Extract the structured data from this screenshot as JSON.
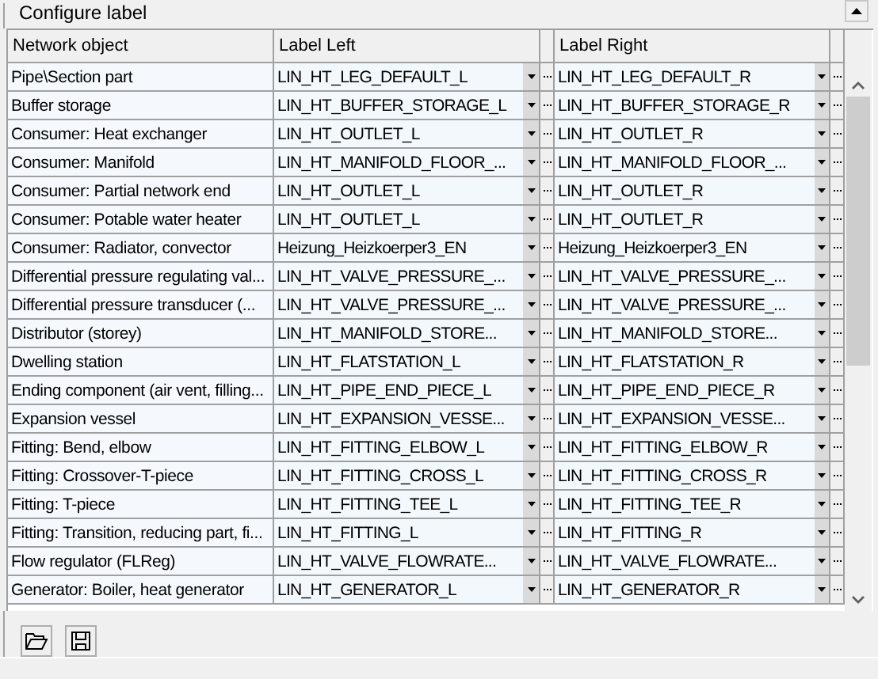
{
  "group": {
    "title": "Configure label"
  },
  "columns": [
    "Network object",
    "Label Left",
    "Label Right"
  ],
  "rows": [
    {
      "object": "Pipe\\Section part",
      "label_left": "LIN_HT_LEG_DEFAULT_L",
      "label_right": "LIN_HT_LEG_DEFAULT_R"
    },
    {
      "object": "Buffer storage",
      "label_left": "LIN_HT_BUFFER_STORAGE_L",
      "label_right": "LIN_HT_BUFFER_STORAGE_R"
    },
    {
      "object": "Consumer: Heat exchanger",
      "label_left": "LIN_HT_OUTLET_L",
      "label_right": "LIN_HT_OUTLET_R"
    },
    {
      "object": "Consumer: Manifold",
      "label_left": "LIN_HT_MANIFOLD_FLOOR_...",
      "label_right": "LIN_HT_MANIFOLD_FLOOR_..."
    },
    {
      "object": "Consumer: Partial network end",
      "label_left": "LIN_HT_OUTLET_L",
      "label_right": "LIN_HT_OUTLET_R"
    },
    {
      "object": "Consumer: Potable water heater",
      "label_left": "LIN_HT_OUTLET_L",
      "label_right": "LIN_HT_OUTLET_R"
    },
    {
      "object": "Consumer: Radiator, convector",
      "label_left": "Heizung_Heizkoerper3_EN",
      "label_right": "Heizung_Heizkoerper3_EN"
    },
    {
      "object": "Differential pressure regulating val...",
      "label_left": "LIN_HT_VALVE_PRESSURE_...",
      "label_right": "LIN_HT_VALVE_PRESSURE_..."
    },
    {
      "object": "Differential pressure transducer (...",
      "label_left": "LIN_HT_VALVE_PRESSURE_...",
      "label_right": "LIN_HT_VALVE_PRESSURE_..."
    },
    {
      "object": "Distributor (storey)",
      "label_left": "LIN_HT_MANIFOLD_STORE...",
      "label_right": "LIN_HT_MANIFOLD_STORE..."
    },
    {
      "object": "Dwelling station",
      "label_left": "LIN_HT_FLATSTATION_L",
      "label_right": "LIN_HT_FLATSTATION_R"
    },
    {
      "object": "Ending component (air vent, filling...",
      "label_left": "LIN_HT_PIPE_END_PIECE_L",
      "label_right": "LIN_HT_PIPE_END_PIECE_R"
    },
    {
      "object": "Expansion vessel",
      "label_left": "LIN_HT_EXPANSION_VESSE...",
      "label_right": "LIN_HT_EXPANSION_VESSE..."
    },
    {
      "object": "Fitting: Bend, elbow",
      "label_left": "LIN_HT_FITTING_ELBOW_L",
      "label_right": "LIN_HT_FITTING_ELBOW_R"
    },
    {
      "object": "Fitting: Crossover-T-piece",
      "label_left": "LIN_HT_FITTING_CROSS_L",
      "label_right": "LIN_HT_FITTING_CROSS_R"
    },
    {
      "object": "Fitting: T-piece",
      "label_left": "LIN_HT_FITTING_TEE_L",
      "label_right": "LIN_HT_FITTING_TEE_R"
    },
    {
      "object": "Fitting: Transition, reducing part, fi...",
      "label_left": "LIN_HT_FITTING_L",
      "label_right": "LIN_HT_FITTING_R"
    },
    {
      "object": "Flow regulator (FLReg)",
      "label_left": "LIN_HT_VALVE_FLOWRATE...",
      "label_right": "LIN_HT_VALVE_FLOWRATE..."
    },
    {
      "object": "Generator: Boiler, heat generator",
      "label_left": "LIN_HT_GENERATOR_L",
      "label_right": "LIN_HT_GENERATOR_R"
    }
  ]
}
